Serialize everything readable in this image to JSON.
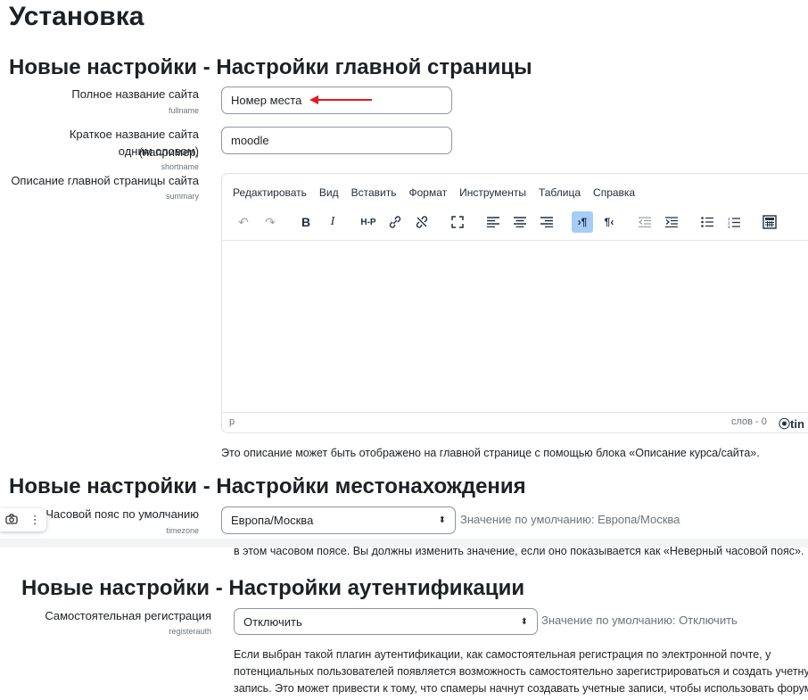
{
  "page": {
    "title": "Установка"
  },
  "front_page": {
    "heading": "Новые настройки - Настройки главной страницы",
    "fullname": {
      "label": "Полное название сайта",
      "key": "fullname",
      "value": "Номер места"
    },
    "shortname": {
      "label_line1": "Краткое название сайта (например,",
      "label_line2": "одним словом)",
      "key": "shortname",
      "value": "moodle"
    },
    "summary": {
      "label": "Описание главной страницы сайта",
      "key": "summary",
      "editor_menu": [
        "Редактировать",
        "Вид",
        "Вставить",
        "Формат",
        "Инструменты",
        "Таблица",
        "Справка"
      ],
      "status_path": "p",
      "word_count": "слов - 0",
      "brand": "tin",
      "description": "Это описание может быть отображено на главной странице с помощью блока «Описание курса/сайта»."
    }
  },
  "location": {
    "heading": "Новые настройки - Настройки местонахождения",
    "timezone": {
      "label": "Часовой пояс по умолчанию",
      "key": "timezone",
      "value": "Европа/Москва",
      "default": "Значение по умолчанию: Европа/Москва",
      "partial_desc": "в этом часовом поясе. Вы должны изменить значение, если оно показывается как «Неверный часовой пояс»."
    }
  },
  "auth": {
    "heading": "Новые настройки - Настройки аутентификации",
    "registerauth": {
      "label": "Самостоятельная регистрация",
      "key": "registerauth",
      "value": "Отключить",
      "default": "Значение по умолчанию: Отключить",
      "desc_line1": "Если выбран такой плагин аутентификации, как самостоятельная регистрация по электронной почте, у",
      "desc_line2": "потенциальных пользователей появляется возможность самостоятельно зарегистрироваться и создать учетну",
      "desc_line3": "запись. Это может привести к тому, что спамеры начнут создавать учетные записи, чтобы использовать форум"
    }
  },
  "colors": {
    "annotation_arrow": "#e01b1b",
    "active_button": "#a6ccf7"
  }
}
